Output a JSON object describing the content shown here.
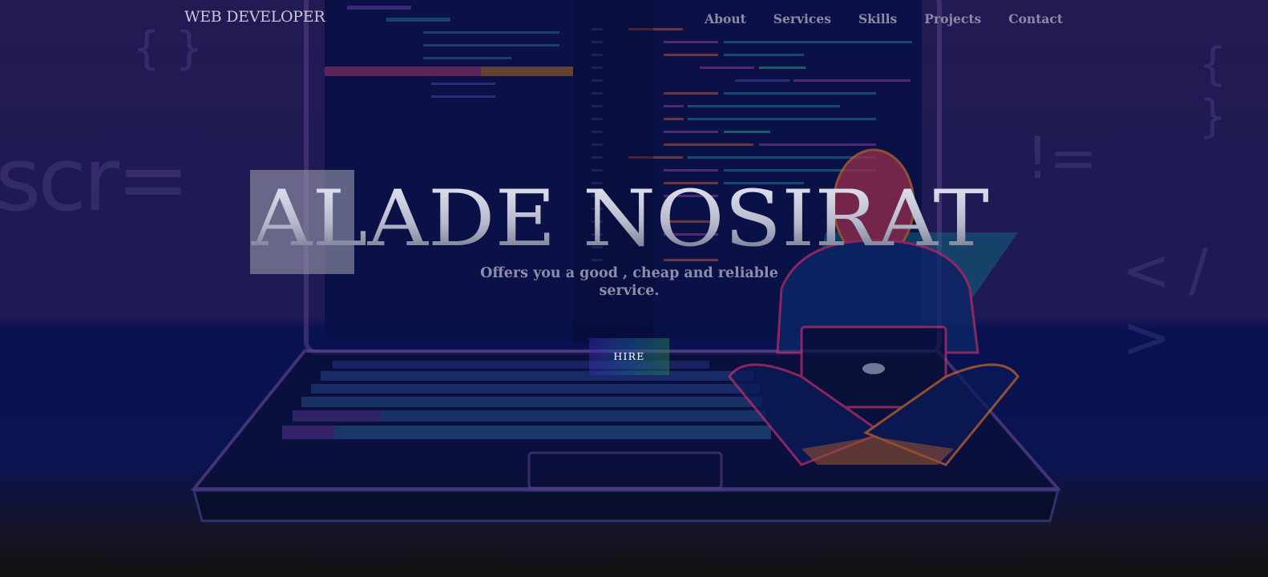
{
  "nav": {
    "logo": "WEB DEVELOPER",
    "items": [
      {
        "label": "About"
      },
      {
        "label": "Services"
      },
      {
        "label": "Skills"
      },
      {
        "label": "Projects"
      },
      {
        "label": "Contact"
      }
    ]
  },
  "hero": {
    "title": "ALADE NOSIRAT",
    "tagline": "Offers you a good , cheap and reliable service.",
    "hire_label": "HIRE"
  },
  "background": {
    "glyphs": [
      "{ }",
      "scr=",
      "{ }",
      "!=",
      "< / >"
    ]
  },
  "colors": {
    "accent": "#00c2a8",
    "nav_text": "#8d8aa8",
    "title_gradient_start": "#3a3d55",
    "title_gradient_end": "#e6e6f2"
  }
}
